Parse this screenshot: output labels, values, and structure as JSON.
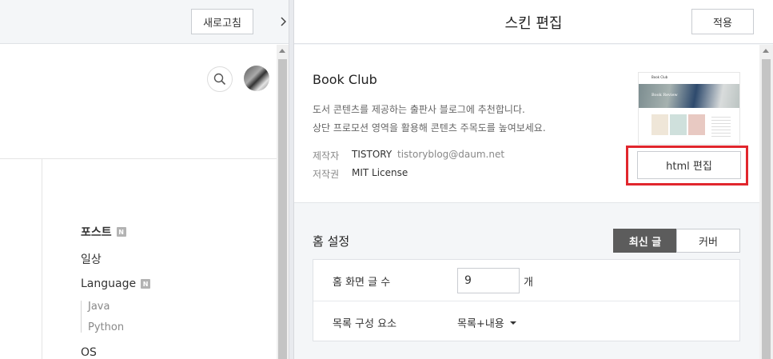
{
  "preview": {
    "refresh_label": "새로고침",
    "categories": [
      {
        "label": "포스트",
        "badge": "N"
      },
      {
        "label": "일상"
      },
      {
        "label": "Language",
        "badge": "N"
      },
      {
        "label": "OS"
      }
    ],
    "subcategories": [
      "Java",
      "Python"
    ]
  },
  "editor": {
    "title": "스킨 편집",
    "apply_label": "적용",
    "skin": {
      "name": "Book Club",
      "description_lines": [
        "도서 콘텐츠를 제공하는 출판사 블로그에 추천합니다.",
        "상단 프로모션 영역을 활용해 콘텐츠 주목도를 높여보세요."
      ],
      "author_label": "제작자",
      "author_name": "TISTORY",
      "author_email": "tistoryblog@daum.net",
      "license_label": "저작권",
      "license": "MIT License",
      "thumbnail_site_title": "Book Club",
      "thumbnail_banner_text": "Book Review",
      "html_edit_label": "html 편집"
    },
    "home_settings": {
      "title": "홈 설정",
      "tabs": [
        {
          "label": "최신 글",
          "active": true
        },
        {
          "label": "커버",
          "active": false
        }
      ],
      "rows": {
        "post_count_label": "홈 화면 글 수",
        "post_count_value": "9",
        "post_count_unit": "개",
        "list_config_label": "목록 구성 요소",
        "list_config_value": "목록+내용"
      }
    }
  },
  "colors": {
    "highlight": "#e1262d",
    "active_tab": "#5c5c5c"
  },
  "icons": [
    "search-icon",
    "chevron-right-icon",
    "caret-down-icon",
    "new-badge-icon"
  ]
}
